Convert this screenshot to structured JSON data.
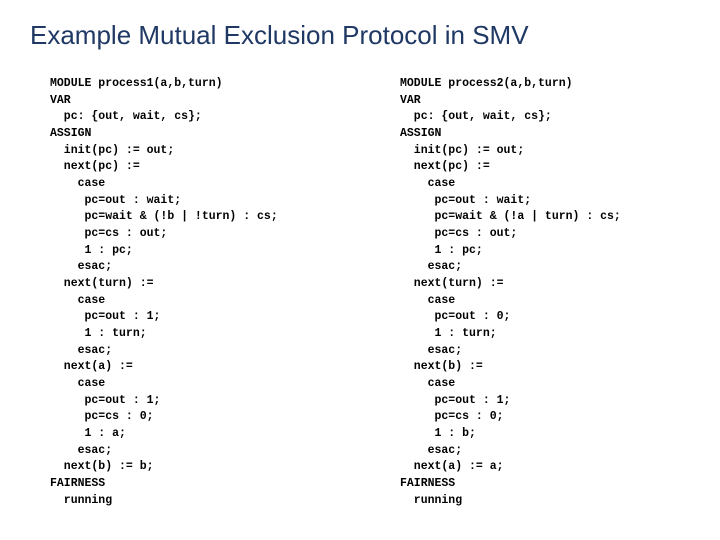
{
  "title": "Example Mutual Exclusion Protocol in SMV",
  "code_left": "MODULE process1(a,b,turn)\nVAR\n  pc: {out, wait, cs};\nASSIGN\n  init(pc) := out;\n  next(pc) :=\n    case\n     pc=out : wait;\n     pc=wait & (!b | !turn) : cs;\n     pc=cs : out;\n     1 : pc;\n    esac;\n  next(turn) :=\n    case\n     pc=out : 1;\n     1 : turn;\n    esac;\n  next(a) :=\n    case\n     pc=out : 1;\n     pc=cs : 0;\n     1 : a;\n    esac;\n  next(b) := b;\nFAIRNESS\n  running",
  "code_right": "MODULE process2(a,b,turn)\nVAR\n  pc: {out, wait, cs};\nASSIGN\n  init(pc) := out;\n  next(pc) :=\n    case\n     pc=out : wait;\n     pc=wait & (!a | turn) : cs;\n     pc=cs : out;\n     1 : pc;\n    esac;\n  next(turn) :=\n    case\n     pc=out : 0;\n     1 : turn;\n    esac;\n  next(b) :=\n    case\n     pc=out : 1;\n     pc=cs : 0;\n     1 : b;\n    esac;\n  next(a) := a;\nFAIRNESS\n  running"
}
